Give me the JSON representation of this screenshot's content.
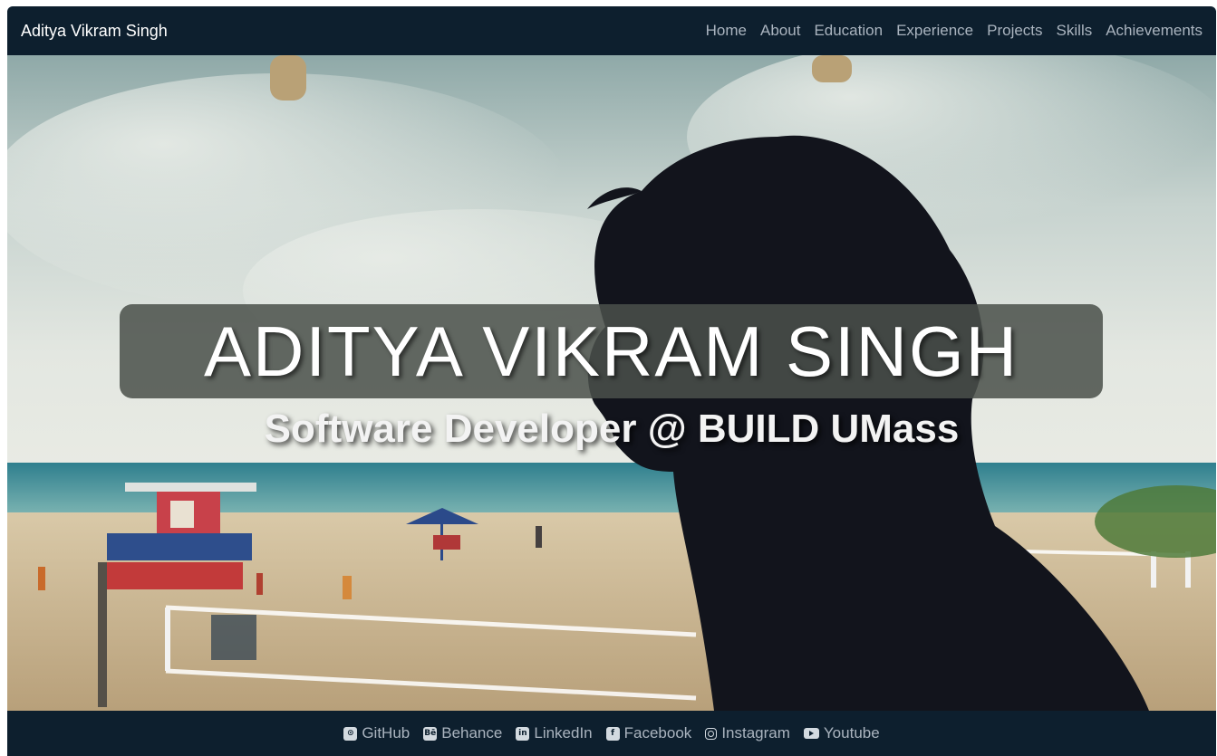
{
  "navbar": {
    "brand": "Aditya Vikram Singh",
    "links": [
      {
        "label": "Home"
      },
      {
        "label": "About"
      },
      {
        "label": "Education"
      },
      {
        "label": "Experience"
      },
      {
        "label": "Projects"
      },
      {
        "label": "Skills"
      },
      {
        "label": "Achievements"
      }
    ]
  },
  "hero": {
    "title": "ADITYA VIKRAM SINGH",
    "subtitle": "Software Developer @ BUILD UMass",
    "background": "photo of person silhouette in profile at a beach"
  },
  "footer": {
    "links": [
      {
        "label": "GitHub",
        "icon": "github-icon"
      },
      {
        "label": "Behance",
        "icon": "behance-icon"
      },
      {
        "label": "LinkedIn",
        "icon": "linkedin-icon"
      },
      {
        "label": "Facebook",
        "icon": "facebook-icon"
      },
      {
        "label": "Instagram",
        "icon": "instagram-icon"
      },
      {
        "label": "Youtube",
        "icon": "youtube-icon"
      }
    ]
  },
  "colors": {
    "navbar_bg": "#0d1f2e",
    "nav_text": "#aab4bf",
    "title_box": "#4b504a"
  }
}
